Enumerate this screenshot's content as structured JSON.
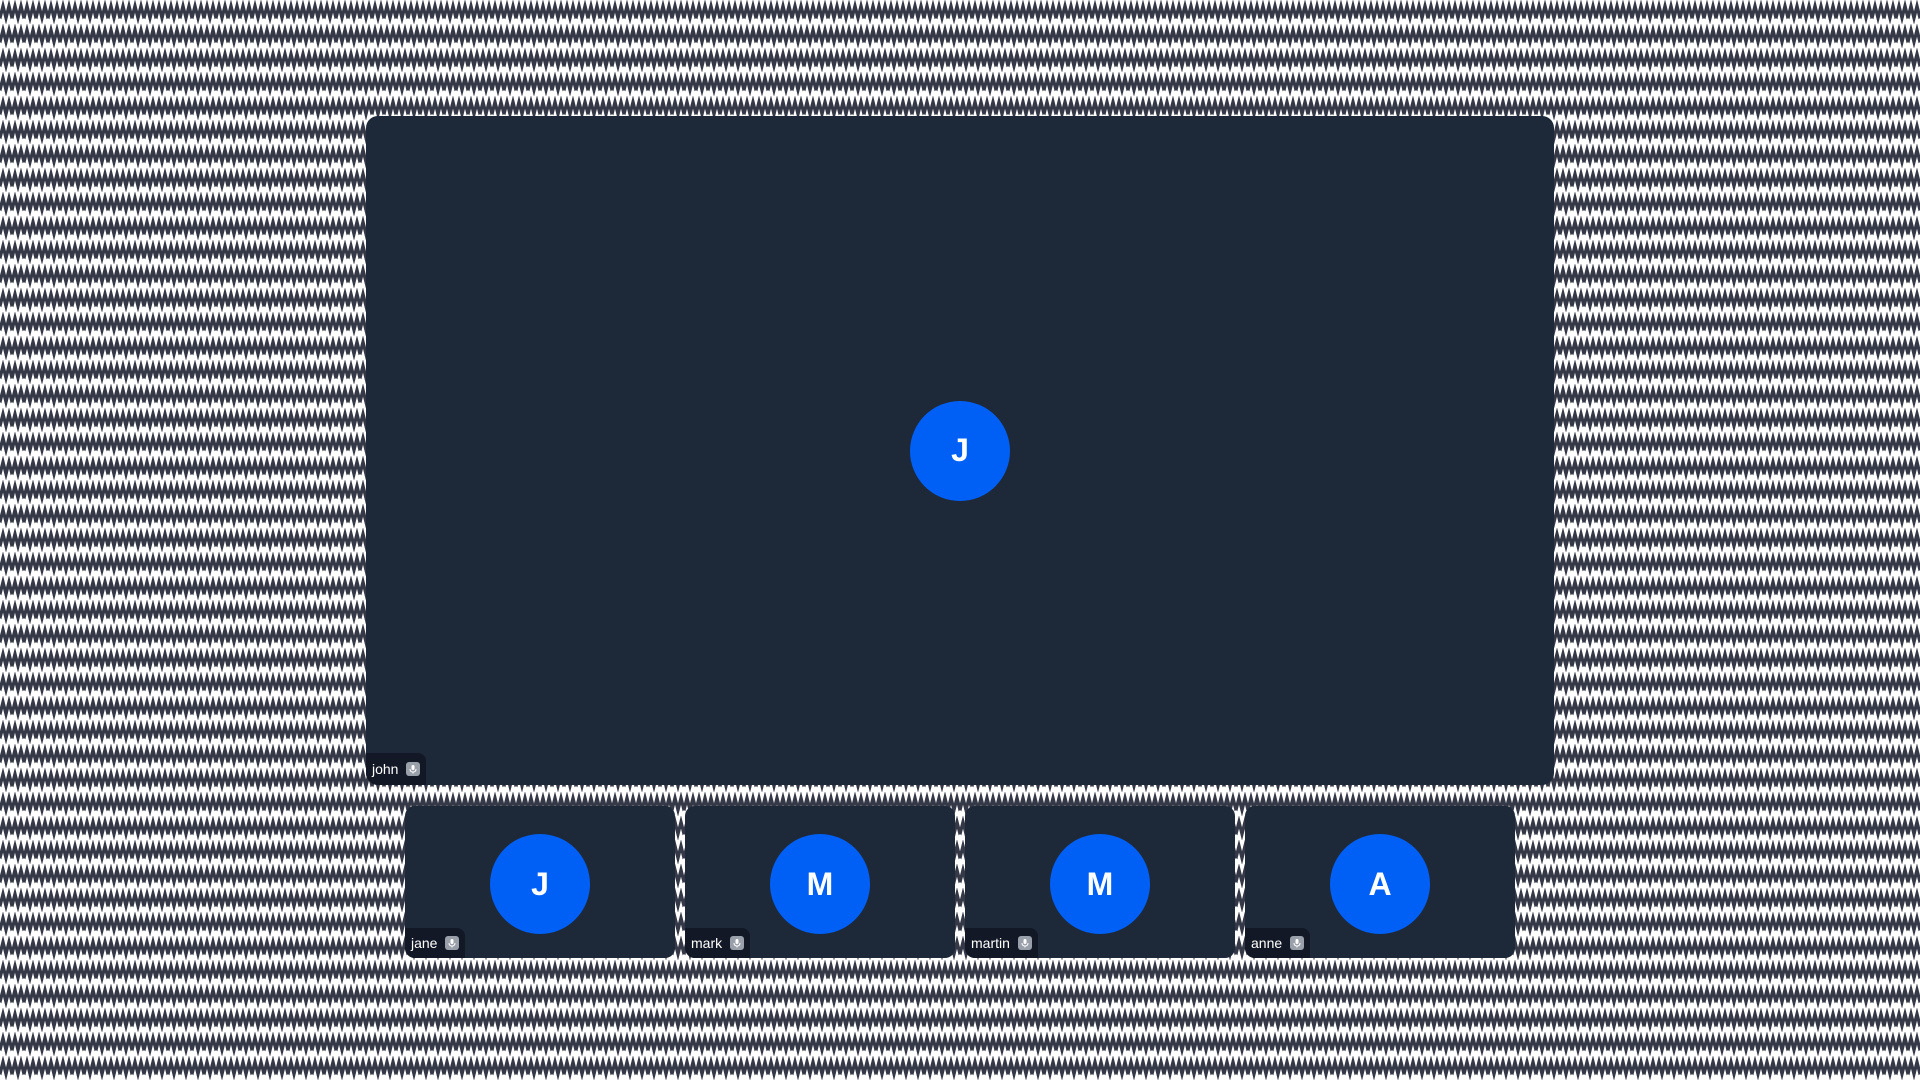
{
  "colors": {
    "tile_background": "#1d2939",
    "avatar_background": "#0060f5",
    "name_tag_background": "#121826",
    "pattern": "#353846"
  },
  "main_participant": {
    "name": "john",
    "initial": "J",
    "icon": "mic-icon"
  },
  "participants": [
    {
      "name": "jane",
      "initial": "J",
      "icon": "mic-icon"
    },
    {
      "name": "mark",
      "initial": "M",
      "icon": "mic-icon"
    },
    {
      "name": "martin",
      "initial": "M",
      "icon": "mic-icon"
    },
    {
      "name": "anne",
      "initial": "A",
      "icon": "mic-icon"
    }
  ]
}
